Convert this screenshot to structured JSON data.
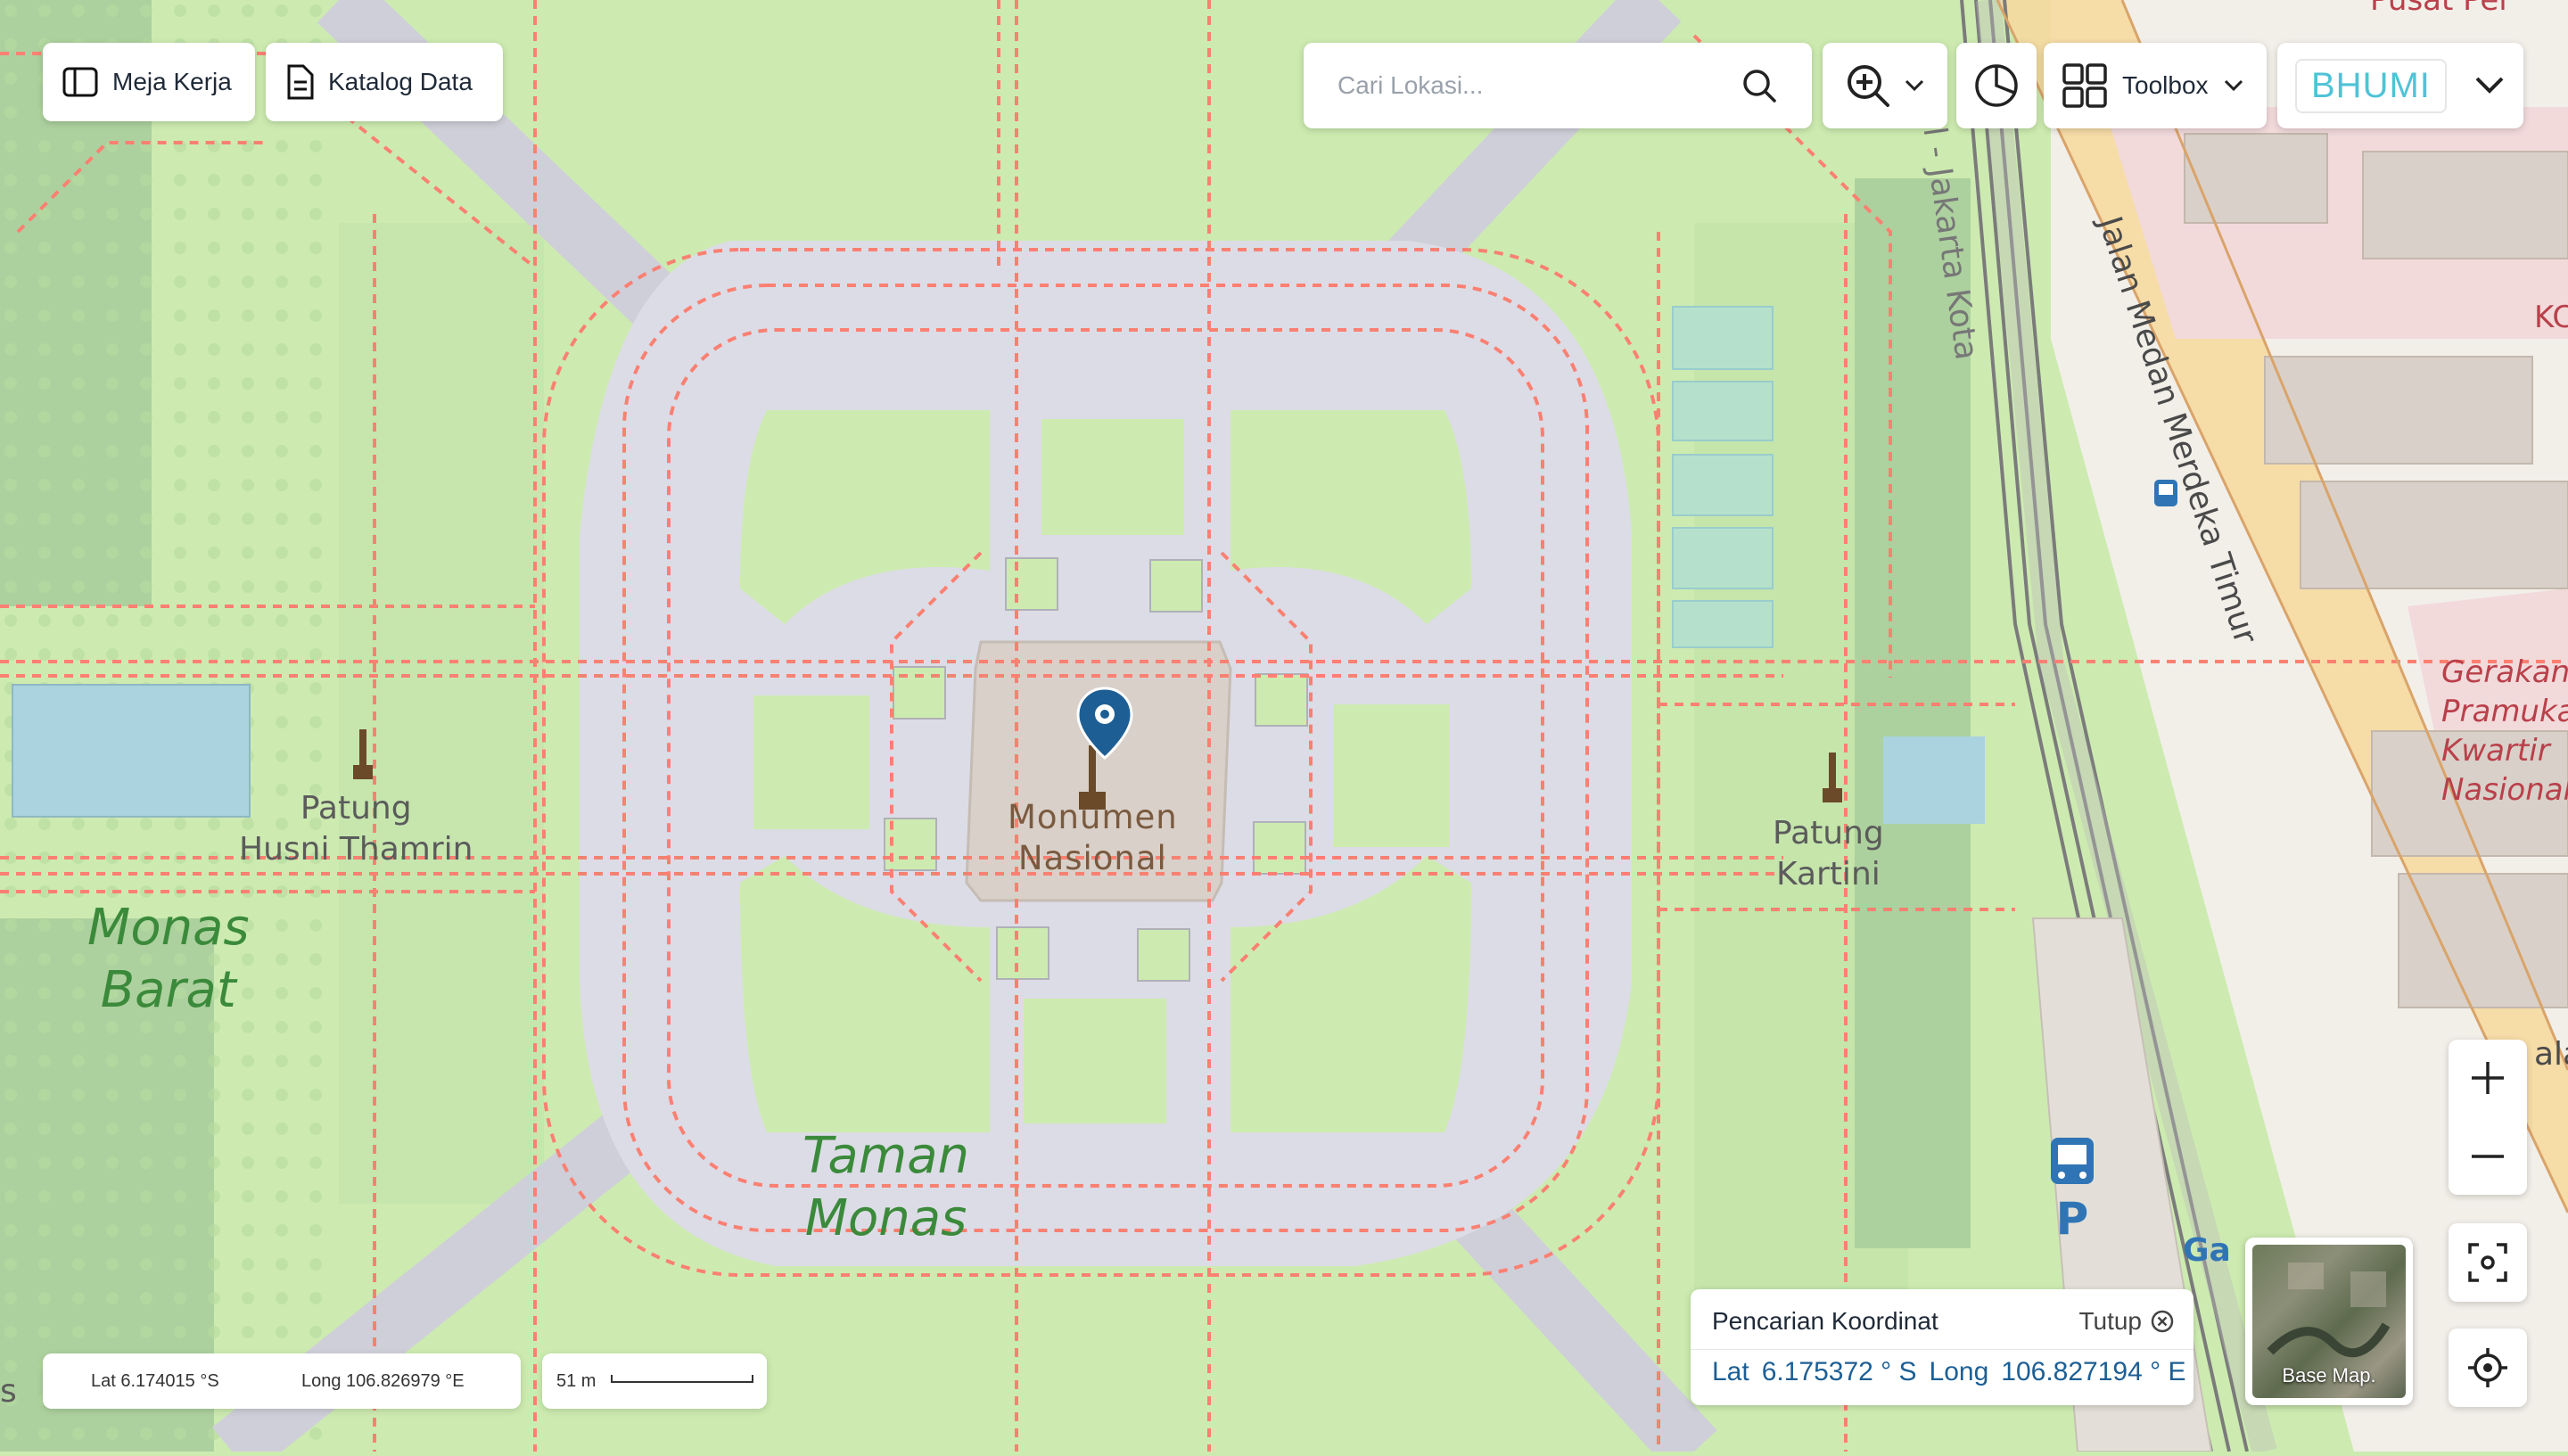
{
  "toolbar_left": {
    "workspace_label": "Meja Kerja",
    "catalog_label": "Katalog Data"
  },
  "search": {
    "placeholder": "Cari Lokasi..."
  },
  "toolbar_right": {
    "toolbox_label": "Toolbox",
    "logo_text": "BHUMI"
  },
  "map": {
    "labels": {
      "monument": [
        "Monumen",
        "Nasional"
      ],
      "statue_west": [
        "Patung",
        "Husni Thamrin"
      ],
      "statue_east": [
        "Patung",
        "Kartini"
      ],
      "park_west": [
        "Monas",
        "Barat"
      ],
      "park_south": [
        "Taman",
        "Monas"
      ],
      "street_east": "Jalan Medan Merdeka Timur",
      "rail_line": "al - Jakarta Kota",
      "district": [
        "Gerakan",
        "Pramuka",
        "Kwartir",
        "Nasional"
      ],
      "top_right": "Pusat Per",
      "edge_ko": "KC",
      "edge_ala": "ala",
      "station_partial": "Ga",
      "edge_s": "s"
    },
    "marker_icon": "map-pin-icon"
  },
  "status": {
    "cursor_lat": "Lat 6.174015 °S",
    "cursor_long": "Long 106.826979 °E",
    "scale_label": "51 m"
  },
  "coordinate_panel": {
    "title": "Pencarian Koordinat",
    "close_label": "Tutup",
    "lat_label": "Lat",
    "lat_value": "6.175372 ° S",
    "long_label": "Long",
    "long_value": "106.827194 ° E"
  },
  "basemap": {
    "label": "Base Map."
  },
  "colors": {
    "park": "#cdebb0",
    "plaza": "#dddde8",
    "path": "#fa8072",
    "accent": "#1d5f95",
    "logo": "#4fc3d6"
  }
}
